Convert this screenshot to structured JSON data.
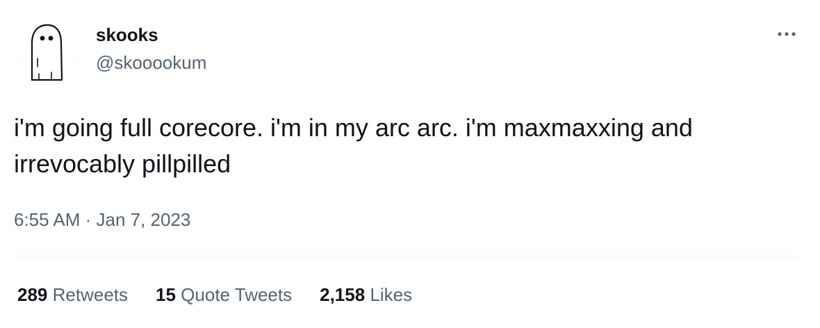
{
  "tweet": {
    "author": {
      "display_name": "skooks",
      "handle": "@skooookum",
      "avatar_icon": "ghost-icon"
    },
    "more_icon": "more-icon",
    "text": "i'm going full corecore. i'm in my arc arc. i'm maxmaxxing and irrevocably pillpilled",
    "timestamp": "6:55 AM · Jan 7, 2023",
    "stats": {
      "retweets": {
        "count": "289",
        "label": "Retweets"
      },
      "quote_tweets": {
        "count": "15",
        "label": "Quote Tweets"
      },
      "likes": {
        "count": "2,158",
        "label": "Likes"
      }
    },
    "colors": {
      "text": "#0f1419",
      "secondary": "#536471",
      "divider": "#eff3f4"
    }
  }
}
